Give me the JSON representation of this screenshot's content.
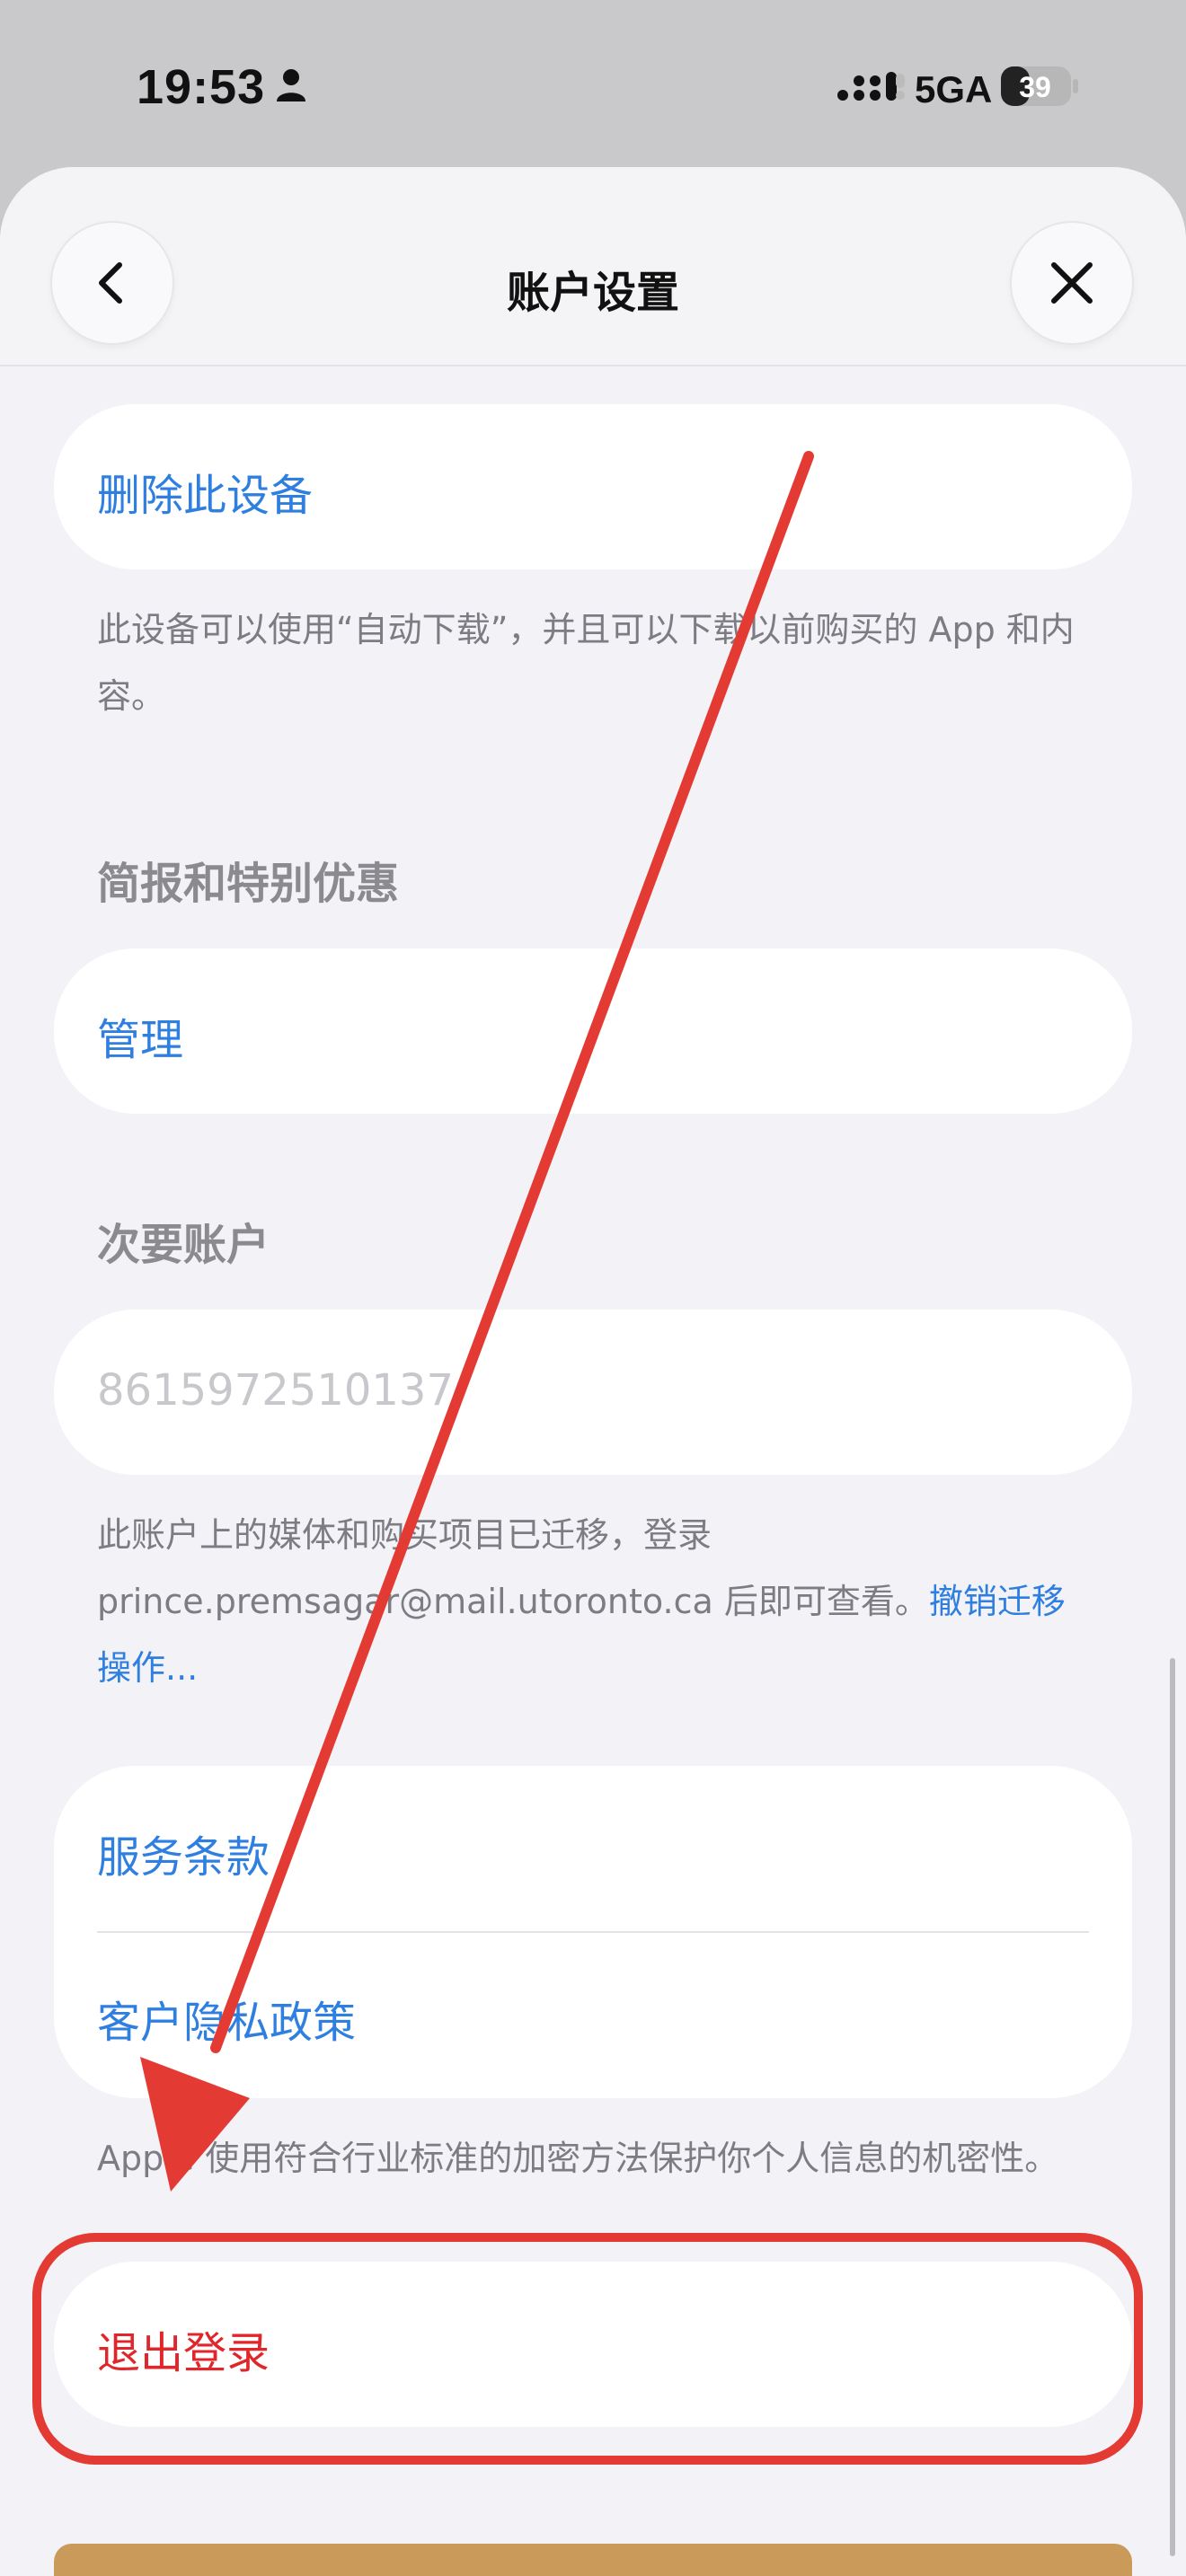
{
  "status_bar": {
    "time": "19:53",
    "network": "5GA",
    "battery": "39"
  },
  "nav": {
    "title": "账户设置"
  },
  "sections": {
    "remove_device": {
      "button": "删除此设备",
      "footnote": "此设备可以使用“自动下载”，并且可以下载以前购买的 App 和内容。"
    },
    "newsletters": {
      "header": "简报和特别优惠",
      "button": "管理"
    },
    "secondary_account": {
      "header": "次要账户",
      "value": "8615972510137",
      "footnote_text": "此账户上的媒体和购买项目已迁移，登录 prince.premsagar@mail.utoronto.ca 后即可查看。",
      "footnote_link": "撤销迁移操作..."
    },
    "legal": {
      "terms": "服务条款",
      "privacy": "客户隐私政策",
      "footnote": "Apple 使用符合行业标准的加密方法保护你个人信息的机密性。"
    },
    "sign_out": {
      "button": "退出登录"
    }
  },
  "colors": {
    "link": "#2f7fe0",
    "destructive": "#e0262a",
    "annotation": "#e33b33"
  }
}
